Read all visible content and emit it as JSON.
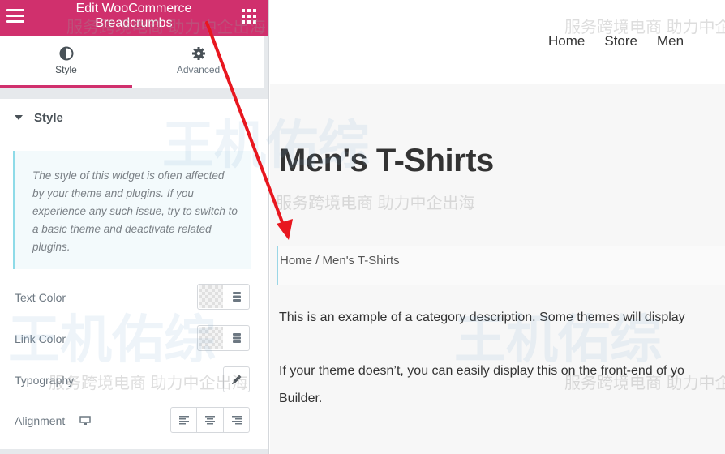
{
  "editor": {
    "header": {
      "title": "Edit WooCommerce Breadcrumbs",
      "menu_icon": "hamburger-icon",
      "widgets_icon": "grid-icon",
      "accent_color": "#d0306d"
    },
    "tabs": [
      {
        "label": "Style",
        "icon": "contrast-icon",
        "active": true
      },
      {
        "label": "Advanced",
        "icon": "gear-icon",
        "active": false
      }
    ],
    "section": {
      "title": "Style"
    },
    "notice": "The style of this widget is often affected by your theme and plugins. If you experience any such issue, try to switch to a basic theme and deactivate related plugins.",
    "controls": {
      "text_color": "Text Color",
      "link_color": "Link Color",
      "typography": "Typography",
      "alignment": "Alignment"
    }
  },
  "preview": {
    "nav": [
      "Home",
      "Store",
      "Men"
    ],
    "page_title": "Men's T-Shirts",
    "breadcrumb": "Home / Men's T-Shirts",
    "description_1": "This is an example of a category description. Some themes will display",
    "description_2": "If your theme doesn’t, you can easily display this on the front-end of yo",
    "description_3": "Builder."
  },
  "watermark": {
    "text": "服务跨境电商 助力中企出海",
    "brand": "王机佑综"
  },
  "annotation": {
    "color": "#e8171f"
  }
}
